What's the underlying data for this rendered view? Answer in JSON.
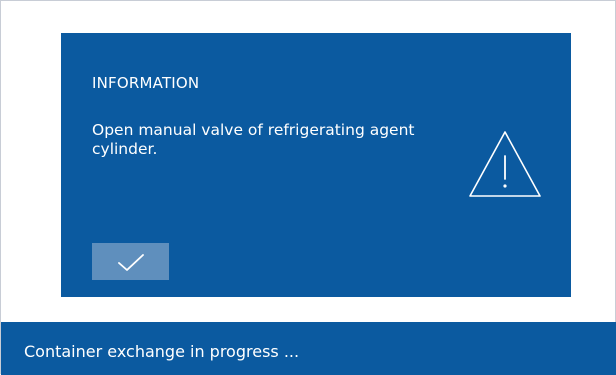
{
  "dialog": {
    "title": "INFORMATION",
    "message": "Open manual valve of refrigerating agent cylinder.",
    "icon": "warning-triangle-icon",
    "confirm_icon": "checkmark-icon"
  },
  "status_bar": {
    "text": "Container exchange in progress ..."
  },
  "colors": {
    "panel_blue": "#0b5aa0",
    "button_blue": "#5f8fbd",
    "text_white": "#ffffff",
    "background": "#ffffff"
  }
}
